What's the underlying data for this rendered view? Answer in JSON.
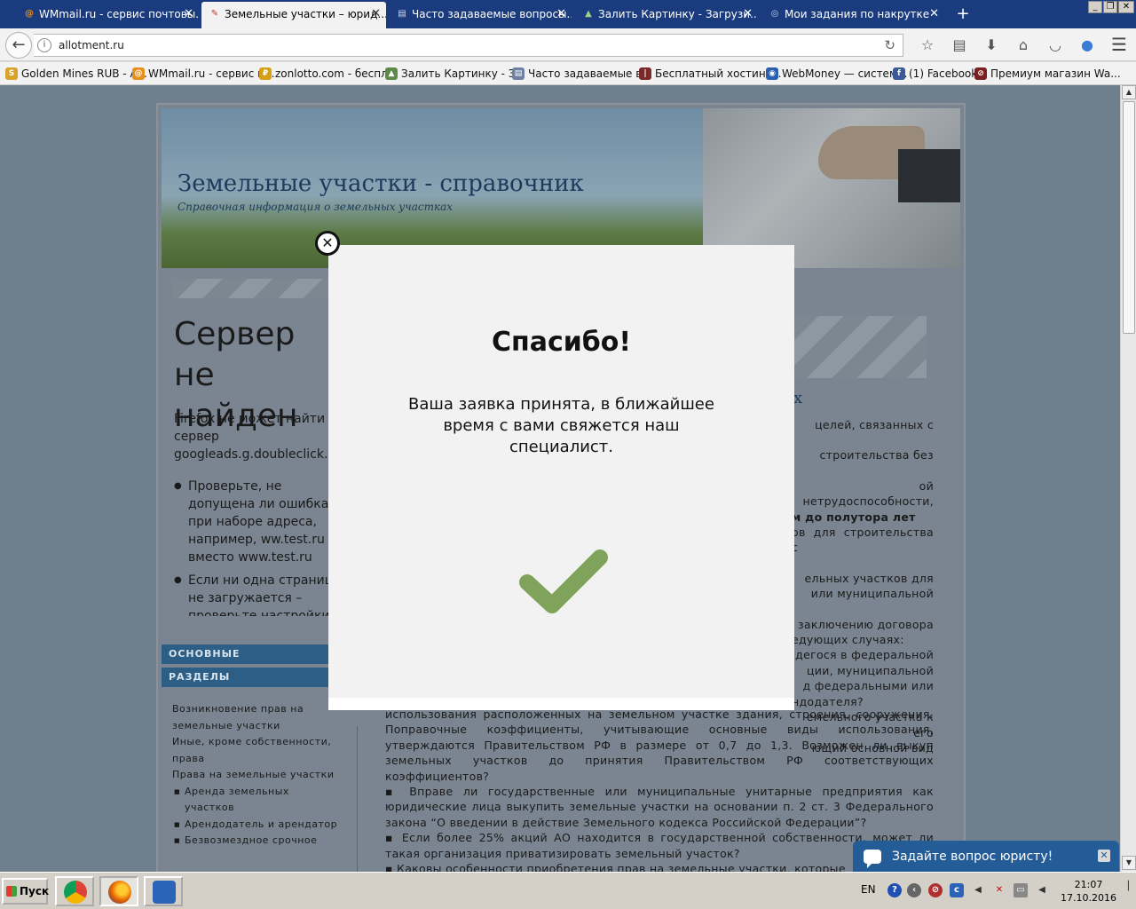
{
  "browser": {
    "tabs": [
      {
        "label": "WMmail.ru - сервис почтовы...",
        "icon": "@"
      },
      {
        "label": "Земельные участки – юрид...",
        "icon": "✎"
      },
      {
        "label": "Часто задаваемые вопросы...",
        "icon": "▤"
      },
      {
        "label": "Залить Картинку - Загрузи...",
        "icon": "▲"
      },
      {
        "label": "Мои задания по накрутке",
        "icon": "◎"
      }
    ],
    "new_tab": "+",
    "url": "allotment.ru",
    "bookmarks": [
      {
        "label": "Golden Mines RUB - A...",
        "icon": "S",
        "color": "#d8a32a"
      },
      {
        "label": "WMmail.ru - сервис п...",
        "icon": "@",
        "color": "#e8901c"
      },
      {
        "label": "zonlotto.com - беспл...",
        "icon": "₽",
        "color": "#d4a017"
      },
      {
        "label": "Залить Картинку - З...",
        "icon": "▲",
        "color": "#5d8a4a"
      },
      {
        "label": "Часто задаваемые в...",
        "icon": "▤",
        "color": "#6d7fa3"
      },
      {
        "label": "Бесплатный хостинг...",
        "icon": "|",
        "color": "#7b2a2a"
      },
      {
        "label": "WebMoney — систем...",
        "icon": "◉",
        "color": "#2a5fb0"
      },
      {
        "label": "(1) Facebook",
        "icon": "f",
        "color": "#3b5998"
      },
      {
        "label": "Премиум магазин Wa...",
        "icon": "⊘",
        "color": "#7a2020"
      }
    ]
  },
  "site": {
    "title": "Земельные участки - справочник",
    "subtitle": "Справочная информация о земельных участках",
    "error_title": "Сервер не найден",
    "error_desc": "Firefox не может найти сервер googleads.g.doubleclick.net",
    "error_tips": [
      "Проверьте, не допущена ли ошибка при наборе адреса, например, ww.test.ru вместо www.test.ru",
      "Если ни одна страница не загружается – проверьте настройки соединения с Интернетом"
    ],
    "sidebar_heads": [
      "ОСНОВНЫЕ",
      "РАЗДЕЛЫ"
    ],
    "side_links": [
      {
        "label": "Возникновение прав на земельные участки",
        "sub": false
      },
      {
        "label": "Иные, кроме собственности, права",
        "sub": false
      },
      {
        "label": "Права на земельные участки",
        "sub": false
      },
      {
        "label": "Аренда земельных участков",
        "sub": true
      },
      {
        "label": "Арендодатель и арендатор",
        "sub": true
      },
      {
        "label": "Безвозмездное срочное",
        "sub": true
      }
    ],
    "right_link": "х",
    "right_lines": [
      "целей, связанных с",
      "строительства без",
      "ой нетрудоспособности,",
      "м до полутора лет",
      "ов для строительства с",
      "ельных участков для",
      "или муниципальной",
      "заключению договора",
      "едующих случаях:",
      "дегося в федеральной",
      "ции, муниципальной",
      "д федеральными или",
      "ндодателя?",
      "емельного участка к его",
      "ющий основной вид"
    ],
    "main_text": [
      "использования расположенных на земельном участке здания, строения, сооружения. Поправочные коэффициенты, учитывающие основные виды использования, утверждаются Правительством РФ в размере от 0,7 до 1,3. Возможен ли выкуп земельных участков до принятия Правительством РФ соответствующих коэффициентов?",
      "▪ Вправе ли государственные или муниципальные унитарные предприятия как юридические лица выкупить земельные участки на основании п. 2 ст. 3 Федерального закона “О введении в действие Земельного кодекса Российской Федерации”?",
      "▪ Если более 25% акций АО находится в государственной собственности, может ли такая организация приватизировать земельный участок?",
      "▪ Каковы особенности приобретения прав на земельные участки, которые"
    ],
    "chat_label": "Задайте вопрос юристу!"
  },
  "modal": {
    "title": "Спасибо!",
    "message": "Ваша заявка принята, в ближайшее время с вами свяжется наш специалист.",
    "check_color": "#7fa35a"
  },
  "taskbar": {
    "start": "Пуск",
    "lang": "EN",
    "time": "21:07",
    "date": "17.10.2016"
  }
}
